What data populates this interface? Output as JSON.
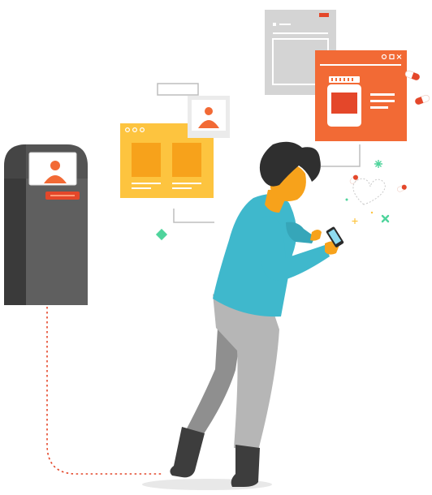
{
  "illustration": {
    "colors": {
      "kiosk_body": "#4a4a4a",
      "kiosk_side": "#6e6e6e",
      "accent_orange": "#f26a35",
      "accent_red": "#e4472a",
      "skin": "#f7a21b",
      "shirt": "#3fb8cc",
      "pants": "#b6b6b6",
      "hair": "#2f2f2f",
      "window_yellow": "#fdc43f",
      "window_grey": "#d4d4d4",
      "sparkle_green": "#4fd49c"
    },
    "icons": [
      "kiosk-icon",
      "dotted-connection-line",
      "browser-window-yellow",
      "photo-card",
      "browser-window-grey",
      "browser-window-orange",
      "medicine-bottle-icon",
      "pill-icon",
      "phone-icon",
      "sparkle-icon"
    ]
  }
}
